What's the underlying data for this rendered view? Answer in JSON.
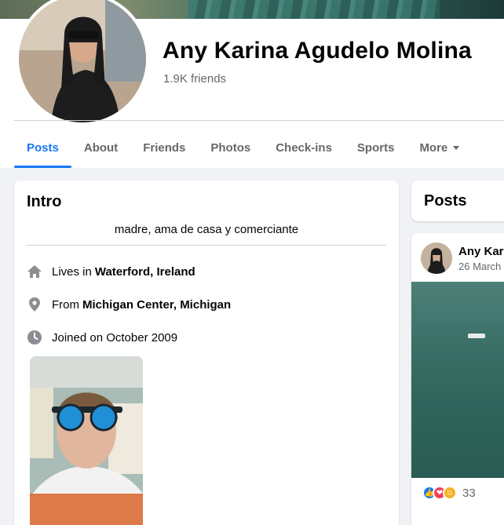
{
  "profile": {
    "name": "Any Karina Agudelo Molina",
    "friends": "1.9K friends"
  },
  "tabs": [
    {
      "label": "Posts",
      "active": true
    },
    {
      "label": "About"
    },
    {
      "label": "Friends"
    },
    {
      "label": "Photos"
    },
    {
      "label": "Check-ins"
    },
    {
      "label": "Sports"
    },
    {
      "label": "More"
    }
  ],
  "intro": {
    "title": "Intro",
    "bio": "madre, ama de casa y comerciante",
    "lives_prefix": "Lives in",
    "lives_value": "Waterford, Ireland",
    "from_prefix": "From",
    "from_value": "Michigan Center, Michigan",
    "joined": "Joined on October 2009"
  },
  "posts": {
    "header": "Posts",
    "author": "Any Karina Agudelo Molina",
    "date": "26 March",
    "reaction_count": "33"
  },
  "colors": {
    "accent": "#1877f2",
    "secondary_text": "#65676b",
    "like": "#1877f2",
    "love": "#f33e58",
    "care": "#f7b125"
  },
  "icons": [
    "home-icon",
    "location-pin-icon",
    "clock-icon",
    "like-reaction-icon",
    "love-reaction-icon",
    "care-reaction-icon",
    "chevron-down-icon"
  ]
}
